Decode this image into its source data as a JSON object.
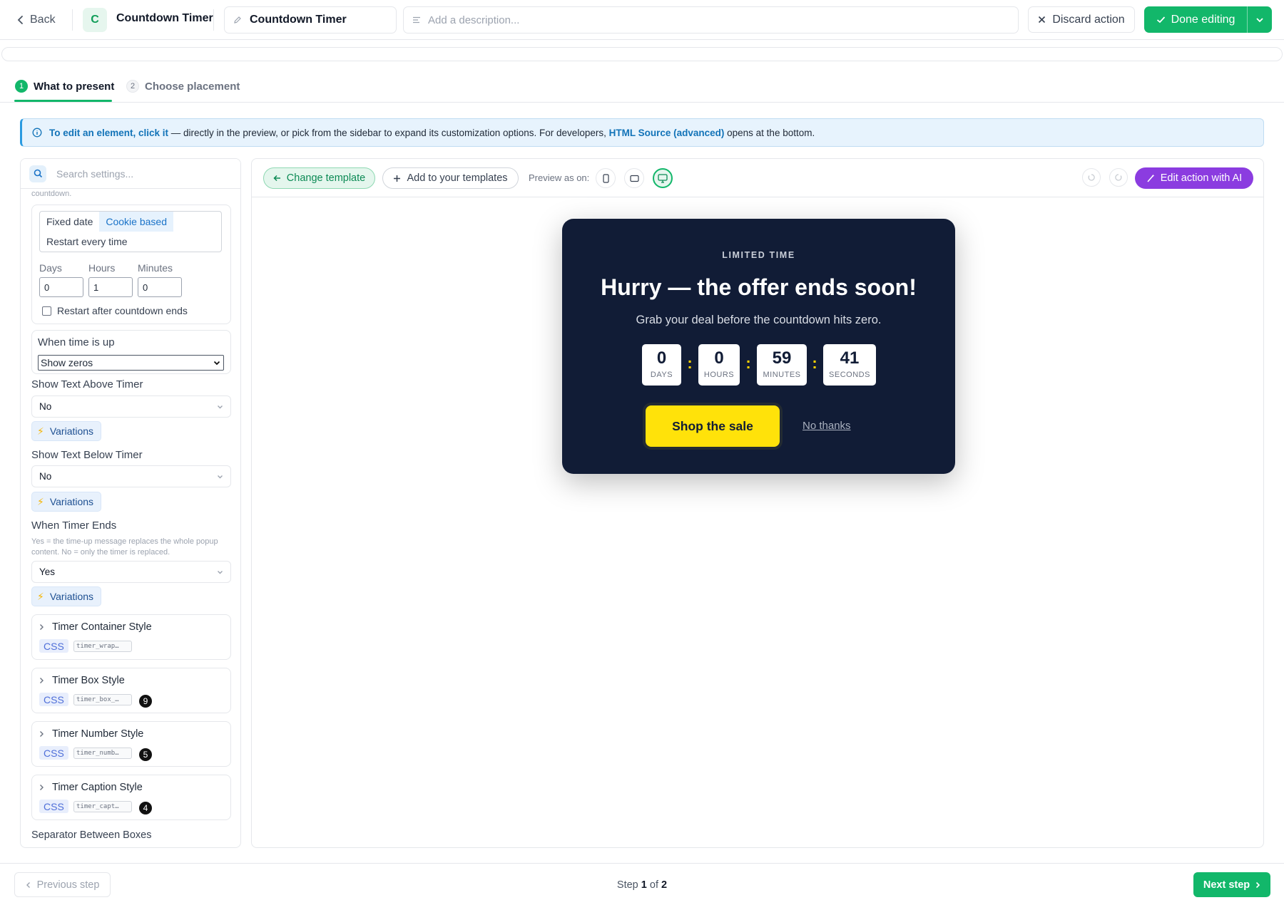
{
  "topbar": {
    "back_label": "Back",
    "avatar_letter": "C",
    "app_title": "Countdown Timer",
    "name_value": "Countdown Timer",
    "description_placeholder": "Add a description...",
    "discard_label": "Discard action",
    "done_label": "Done editing"
  },
  "steps": [
    {
      "num": "1",
      "label": "What to present",
      "active": true
    },
    {
      "num": "2",
      "label": "Choose placement",
      "active": false
    }
  ],
  "info_banner": {
    "lead": "To edit an element, click it",
    "middle": " — directly in the preview, or pick from the sidebar to expand its customization options. For developers, ",
    "link": "HTML Source (advanced)",
    "tail": " opens at the bottom."
  },
  "sidebar": {
    "search_placeholder": "Search settings...",
    "truncated_hint": "countdown.",
    "mode_options": [
      "Fixed date",
      "Cookie based",
      "Restart every time"
    ],
    "mode_selected": "Cookie based",
    "duration": {
      "days_label": "Days",
      "days_value": "0",
      "hours_label": "Hours",
      "hours_value": "1",
      "minutes_label": "Minutes",
      "minutes_value": "0"
    },
    "restart_label": "Restart after countdown ends",
    "restart_checked": false,
    "time_up_label": "When time is up",
    "time_up_value": "Show zeros",
    "show_text_above_label": "Show Text Above Timer",
    "show_text_above_value": "No",
    "show_text_below_label": "Show Text Below Timer",
    "show_text_below_value": "No",
    "variations_label": "Variations",
    "when_timer_ends_label": "When Timer Ends",
    "when_timer_ends_help": "Yes = the time-up message replaces the whole popup content. No = only the timer is replaced.",
    "when_timer_ends_value": "Yes",
    "css_label": "CSS",
    "style_groups": [
      {
        "title": "Timer Container Style",
        "code": "timer_wrap…",
        "count": ""
      },
      {
        "title": "Timer Box Style",
        "code": "timer_box_…",
        "count": "9"
      },
      {
        "title": "Timer Number Style",
        "code": "timer_numb…",
        "count": "5"
      },
      {
        "title": "Timer Caption Style",
        "code": "timer_capt…",
        "count": "4"
      }
    ],
    "separator_label": "Separator Between Boxes"
  },
  "preview_toolbar": {
    "change_template": "Change template",
    "add_template": "Add to your templates",
    "preview_as": "Preview as on:",
    "devices": [
      "phone-icon",
      "tablet-icon",
      "desktop-icon"
    ],
    "active_device": "desktop-icon",
    "edit_ai": "Edit action with AI"
  },
  "popup": {
    "eyebrow": "LIMITED TIME",
    "headline": "Hurry — the offer ends soon!",
    "subtext": "Grab your deal before the countdown hits zero.",
    "timer": [
      {
        "value": "0",
        "caption": "DAYS"
      },
      {
        "value": "0",
        "caption": "HOURS"
      },
      {
        "value": "59",
        "caption": "MINUTES"
      },
      {
        "value": "41",
        "caption": "SECONDS"
      }
    ],
    "separator": ":",
    "cta": "Shop the sale",
    "decline": "No thanks"
  },
  "footer": {
    "prev_label": "Previous step",
    "step_prefix": "Step",
    "step_current": "1",
    "step_of": "of",
    "step_total": "2",
    "next_label": "Next step"
  },
  "colors": {
    "accent_green": "#12b76a",
    "ai_purple": "#8b3ce0",
    "popup_bg": "#111c36",
    "cta_yellow": "#ffe20a"
  }
}
